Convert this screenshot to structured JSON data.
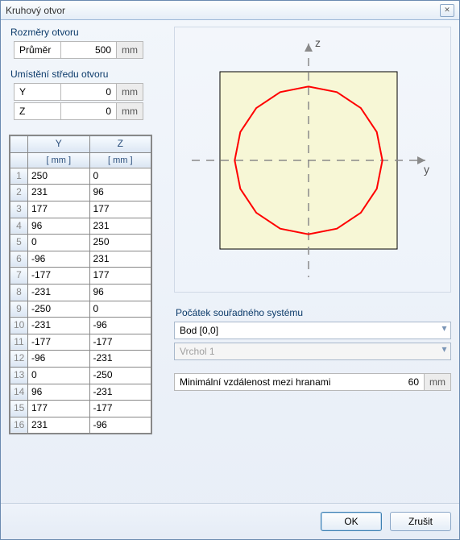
{
  "window": {
    "title": "Kruhový otvor"
  },
  "dimensions": {
    "heading": "Rozměry otvoru",
    "diameter_label": "Průměr",
    "diameter_value": "500",
    "diameter_unit": "mm"
  },
  "center": {
    "heading": "Umístění středu otvoru",
    "y_label": "Y",
    "y_value": "0",
    "y_unit": "mm",
    "z_label": "Z",
    "z_value": "0",
    "z_unit": "mm"
  },
  "table": {
    "col_y": "Y",
    "col_z": "Z",
    "unit_y": "[ mm ]",
    "unit_z": "[ mm ]",
    "rows": [
      {
        "n": "1",
        "y": "250",
        "z": "0"
      },
      {
        "n": "2",
        "y": "231",
        "z": "96"
      },
      {
        "n": "3",
        "y": "177",
        "z": "177"
      },
      {
        "n": "4",
        "y": "96",
        "z": "231"
      },
      {
        "n": "5",
        "y": "0",
        "z": "250"
      },
      {
        "n": "6",
        "y": "-96",
        "z": "231"
      },
      {
        "n": "7",
        "y": "-177",
        "z": "177"
      },
      {
        "n": "8",
        "y": "-231",
        "z": "96"
      },
      {
        "n": "9",
        "y": "-250",
        "z": "0"
      },
      {
        "n": "10",
        "y": "-231",
        "z": "-96"
      },
      {
        "n": "11",
        "y": "-177",
        "z": "-177"
      },
      {
        "n": "12",
        "y": "-96",
        "z": "-231"
      },
      {
        "n": "13",
        "y": "0",
        "z": "-250"
      },
      {
        "n": "14",
        "y": "96",
        "z": "-231"
      },
      {
        "n": "15",
        "y": "177",
        "z": "-177"
      },
      {
        "n": "16",
        "y": "231",
        "z": "-96"
      }
    ]
  },
  "preview": {
    "axis_z": "z",
    "axis_y": "y",
    "square_fill": "#f7f7d6",
    "circle_stroke": "#ff0000",
    "axis_stroke": "#8a8a8a"
  },
  "coordsys": {
    "heading": "Počátek souřadného systému",
    "origin": "Bod [0,0]",
    "vertex": "Vrchol 1"
  },
  "mindist": {
    "label": "Minimální vzdálenost mezi hranami",
    "value": "60",
    "unit": "mm"
  },
  "buttons": {
    "ok": "OK",
    "cancel": "Zrušit"
  }
}
